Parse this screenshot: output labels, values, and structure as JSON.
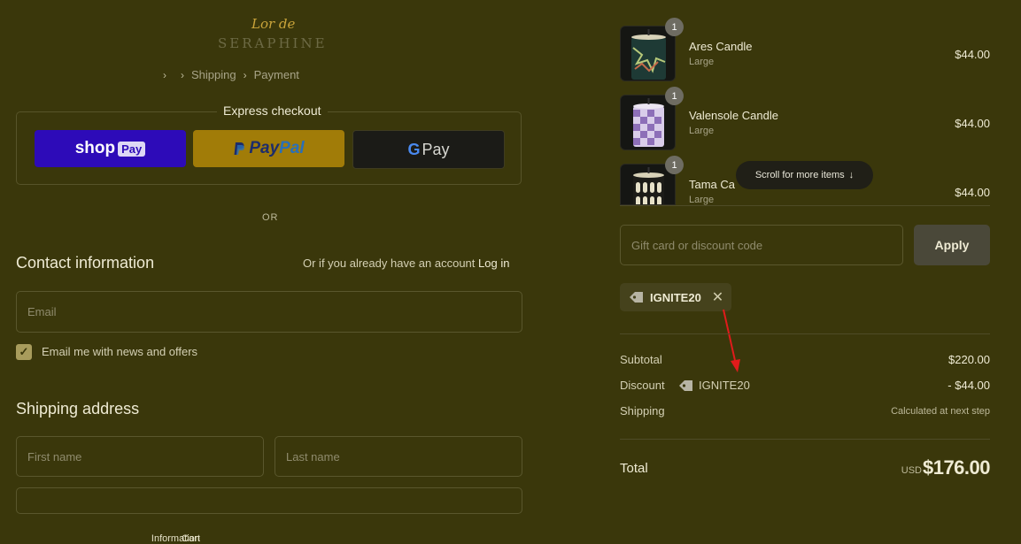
{
  "brand": {
    "script": "Lor de",
    "name": "SERAPHINE"
  },
  "breadcrumb": [
    "Cart",
    "Information",
    "Shipping",
    "Payment"
  ],
  "express": {
    "label": "Express checkout",
    "shop": {
      "text": "shop",
      "badge": "Pay"
    },
    "paypal": {
      "p1": "Pay",
      "p2": "Pal"
    },
    "gpay": {
      "g": "G",
      "text": "Pay"
    }
  },
  "or_label": "OR",
  "contact": {
    "heading": "Contact information",
    "have_account": "Or if you already have an account",
    "login": "Log in",
    "email_placeholder": "Email",
    "newsletter_label": "Email me with news and offers",
    "newsletter_checked": true
  },
  "shipping": {
    "heading": "Shipping address",
    "first_placeholder": "First name",
    "last_placeholder": "Last name"
  },
  "cart": {
    "items": [
      {
        "qty": "1",
        "name": "Ares Candle",
        "variant": "Large",
        "price": "$44.00"
      },
      {
        "qty": "1",
        "name": "Valensole Candle",
        "variant": "Large",
        "price": "$44.00"
      },
      {
        "qty": "1",
        "name": "Tama Ca",
        "variant": "Large",
        "price": "$44.00"
      }
    ],
    "scroll_hint": "Scroll for more items"
  },
  "discount": {
    "placeholder": "Gift card or discount code",
    "apply": "Apply",
    "applied_code": "IGNITE20"
  },
  "summary": {
    "subtotal_label": "Subtotal",
    "subtotal": "$220.00",
    "discount_label": "Discount",
    "discount_code": "IGNITE20",
    "discount": "- $44.00",
    "shipping_label": "Shipping",
    "shipping": "Calculated at next step",
    "total_label": "Total",
    "currency": "USD",
    "total": "$176.00"
  },
  "colors": {
    "background": "#3a370b",
    "shop": "#2d0bb8",
    "paypal": "#a17c08",
    "annotation": "#e01b1b"
  }
}
